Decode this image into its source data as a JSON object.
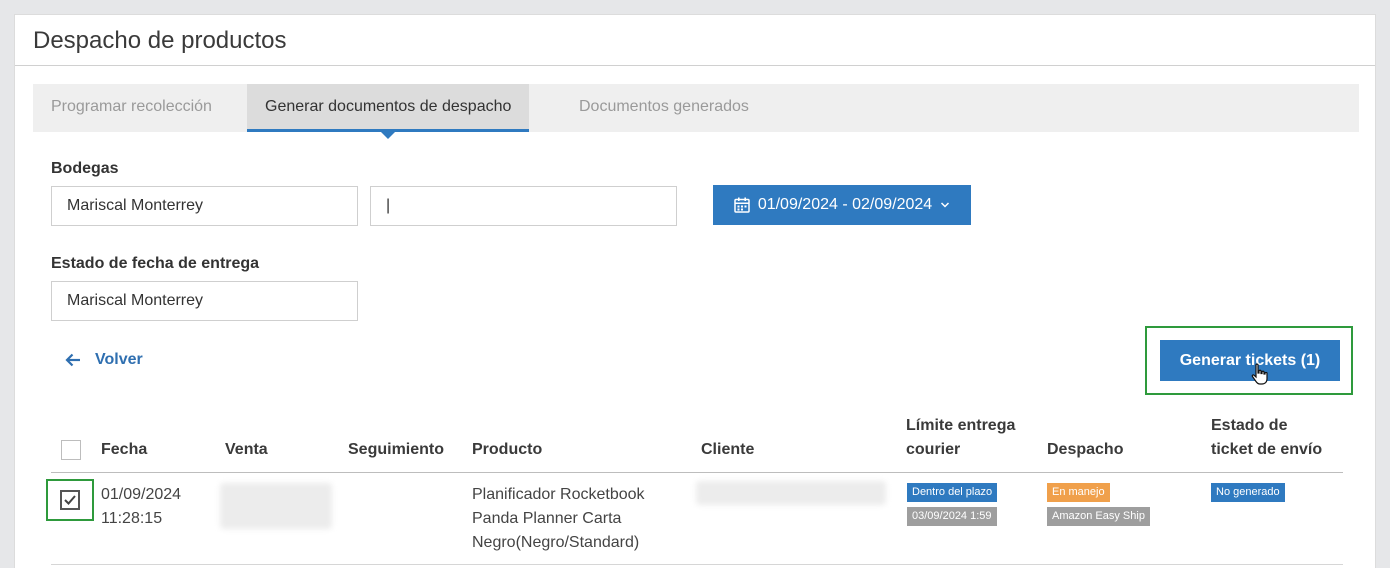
{
  "page": {
    "title": "Despacho de productos"
  },
  "tabs": [
    {
      "label": "Programar recolección",
      "active": false
    },
    {
      "label": "Generar documentos de despacho",
      "active": true
    },
    {
      "label": "Documentos generados",
      "active": false
    }
  ],
  "filters": {
    "bodegas_label": "Bodegas",
    "bodegas_value": "Mariscal Monterrey",
    "search_value": "|",
    "date_range": "01/09/2024 - 02/09/2024",
    "estado_label": "Estado de fecha de entrega",
    "estado_value": "Mariscal Monterrey"
  },
  "actions": {
    "back_label": "Volver",
    "generate_label": "Generar tickets (1)"
  },
  "table": {
    "headers": {
      "fecha": "Fecha",
      "venta": "Venta",
      "seguimiento": "Seguimiento",
      "producto": "Producto",
      "cliente": "Cliente",
      "limite_1": "Límite entrega",
      "limite_2": "courier",
      "despacho": "Despacho",
      "estado_1": "Estado de",
      "estado_2": "ticket de envío"
    },
    "rows": [
      {
        "checked": true,
        "fecha_date": "01/09/2024",
        "fecha_time": "11:28:15",
        "producto_1": "Planificador Rocketbook",
        "producto_2": "Panda Planner Carta",
        "producto_3": "Negro(Negro/Standard)",
        "limite_badge": "Dentro del plazo",
        "limite_date": "03/09/2024 1:59",
        "despacho_badge": "En manejo",
        "despacho_carrier": "Amazon Easy Ship",
        "estado_badge": "No generado"
      }
    ]
  },
  "colors": {
    "primary": "#2f7ac0",
    "highlight": "#2e9a3c",
    "badge_orange": "#f0a04b",
    "badge_gray": "#9e9e9e"
  }
}
